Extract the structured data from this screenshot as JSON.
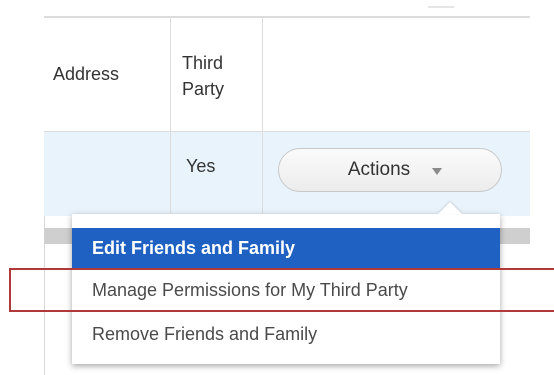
{
  "table": {
    "headers": {
      "address": "Address",
      "third_party": "Third Party"
    },
    "rows": [
      {
        "address": "",
        "third_party": "Yes"
      }
    ]
  },
  "actions_button": {
    "label": "Actions",
    "icon": "chevron-down-icon"
  },
  "menu": {
    "items": [
      {
        "label": "Edit Friends and Family",
        "selected": true
      },
      {
        "label": "Manage Permissions for My Third Party",
        "selected": false
      },
      {
        "label": "Remove Friends and Family",
        "selected": false
      }
    ]
  },
  "colors": {
    "selected_item": "#1f61c2",
    "row_highlight": "#e9f3fb",
    "annotation_box": "#b03a3a"
  }
}
